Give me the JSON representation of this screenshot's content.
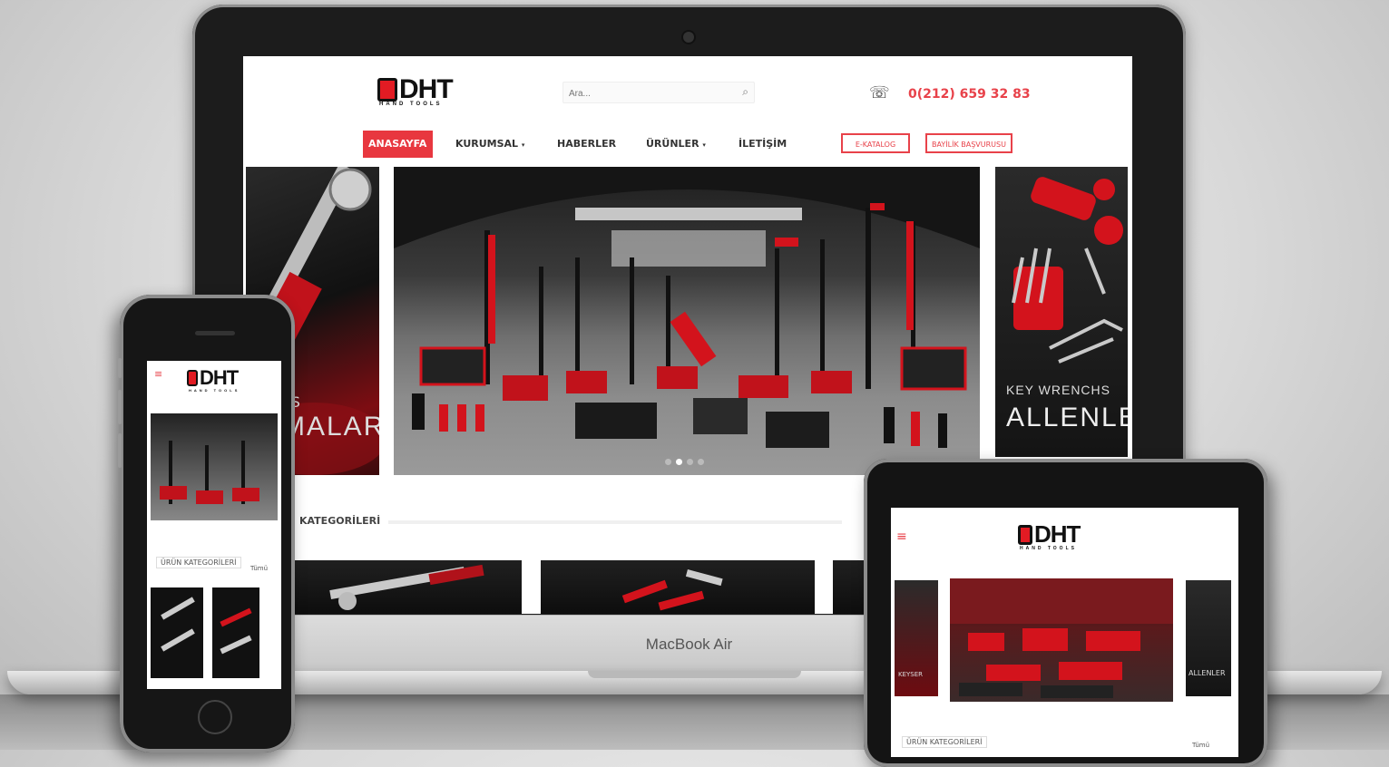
{
  "laptop": {
    "brand": "MacBook Air"
  },
  "site": {
    "logo": {
      "text": "DHT",
      "sub": "HAND TOOLS"
    },
    "search": {
      "placeholder": "Ara..."
    },
    "phone": "0(212) 659 32 83",
    "nav": {
      "home": "ANASAYFA",
      "corporate": "KURUMSAL",
      "news": "HABERLER",
      "products": "ÜRÜNLER",
      "contact": "İLETİŞİM",
      "catalog": "E-KATALOG",
      "dealer": "BAYİLİK BAŞVURUSU"
    },
    "slides": {
      "left_small": "TS",
      "left_big": "MALAR",
      "right_small": "KEY WRENCHS",
      "right_big": "ALLENLER"
    },
    "section_title": "KATEGORİLERİ"
  },
  "phone": {
    "section_label": "ÜRÜN KATEGORİLERİ",
    "more": "Tümü"
  },
  "tablet": {
    "section_label": "ÜRÜN KATEGORİLERİ",
    "more": "Tümü",
    "slide_left": "KEYSER",
    "slide_right": "ALLENLER"
  },
  "colors": {
    "accent": "#e8373f",
    "dark": "#111111"
  }
}
